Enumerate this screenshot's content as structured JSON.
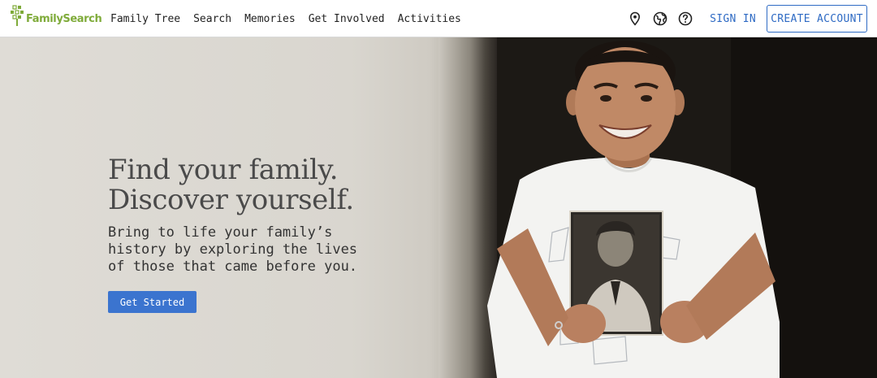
{
  "brand": {
    "name": "FamilySearch",
    "color": "#7fab3a"
  },
  "nav": {
    "items": [
      {
        "label": "Family Tree"
      },
      {
        "label": "Search"
      },
      {
        "label": "Memories"
      },
      {
        "label": "Get Involved"
      },
      {
        "label": "Activities"
      }
    ]
  },
  "utility": {
    "icons": [
      "location-pin-icon",
      "globe-icon",
      "help-icon"
    ],
    "sign_in": "SIGN IN",
    "create_account": "CREATE ACCOUNT",
    "accent": "#2f6bc4"
  },
  "hero": {
    "title": "Find your family.\nDiscover yourself.",
    "subtitle": "Bring to life your family’s history by exploring the lives of those that came before you.",
    "cta_label": "Get Started",
    "cta_color": "#3b74cf"
  }
}
